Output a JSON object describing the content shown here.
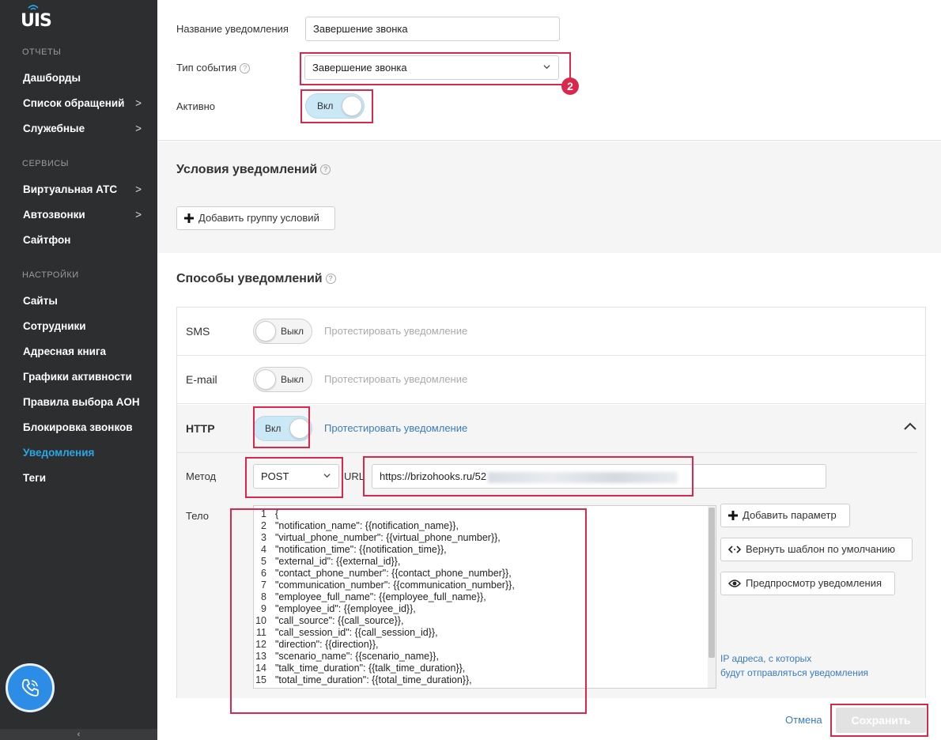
{
  "sidebar": {
    "logo": "UIS",
    "sections": [
      {
        "title": "ОТЧЕТЫ"
      },
      {
        "title": "СЕРВИСЫ"
      },
      {
        "title": "НАСТРОЙКИ"
      }
    ],
    "items": [
      {
        "label": "Дашборды"
      },
      {
        "label": "Список обращений",
        "chevron": ">"
      },
      {
        "label": "Служебные",
        "chevron": ">"
      },
      {
        "label": "Виртуальная АТС",
        "chevron": ">"
      },
      {
        "label": "Автозвонки",
        "chevron": ">"
      },
      {
        "label": "Сайтфон"
      },
      {
        "label": "Сайты"
      },
      {
        "label": "Сотрудники"
      },
      {
        "label": "Адресная книга"
      },
      {
        "label": "Графики активности"
      },
      {
        "label": "Правила выбора АОН"
      },
      {
        "label": "Блокировка звонков"
      },
      {
        "label": "Уведомления",
        "active": true
      },
      {
        "label": "Теги"
      }
    ],
    "collapse": "‹",
    "active_color": "#2aa7e5"
  },
  "form": {
    "name_label": "Название уведомления",
    "name_value": "Завершение звонка",
    "event_label": "Тип события",
    "event_value": "Завершение звонка",
    "active_label": "Активно",
    "active_toggle": "Вкл",
    "badge": "2"
  },
  "conditions": {
    "title": "Условия уведомлений",
    "add_group": "Добавить группу условий"
  },
  "methods": {
    "title": "Способы уведомлений",
    "sms": {
      "name": "SMS",
      "toggle": "Выкл",
      "test": "Протестировать уведомление"
    },
    "email": {
      "name": "E-mail",
      "toggle": "Выкл",
      "test": "Протестировать уведомление"
    },
    "http": {
      "name": "HTTP",
      "toggle": "Вкл",
      "test": "Протестировать уведомление",
      "method_label": "Метод",
      "method_value": "POST",
      "url_label": "URL",
      "url_value": "https://brizohooks.ru/52",
      "body_label": "Тело",
      "body_lines": [
        "{",
        "\"notification_name\": {{notification_name}},",
        "\"virtual_phone_number\": {{virtual_phone_number}},",
        "\"notification_time\": {{notification_time}},",
        "\"external_id\": {{external_id}},",
        "\"contact_phone_number\": {{contact_phone_number}},",
        "\"communication_number\": {{communication_number}},",
        "\"employee_full_name\": {{employee_full_name}},",
        "\"employee_id\": {{employee_id}},",
        "\"call_source\": {{call_source}},",
        "\"call_session_id\": {{call_session_id}},",
        "\"direction\": {{direction}},",
        "\"scenario_name\": {{scenario_name}},",
        "\"talk_time_duration\": {{talk_time_duration}},",
        "\"total_time_duration\": {{total_time_duration}},"
      ],
      "add_param": "Добавить параметр",
      "reset_template": "Вернуть шаблон по умолчанию",
      "preview": "Предпросмотр уведомления",
      "ip_line1": "IP адреса, с которых",
      "ip_line2": "будут отправляться уведомления"
    }
  },
  "footer": {
    "cancel": "Отмена",
    "save": "Сохранить"
  }
}
